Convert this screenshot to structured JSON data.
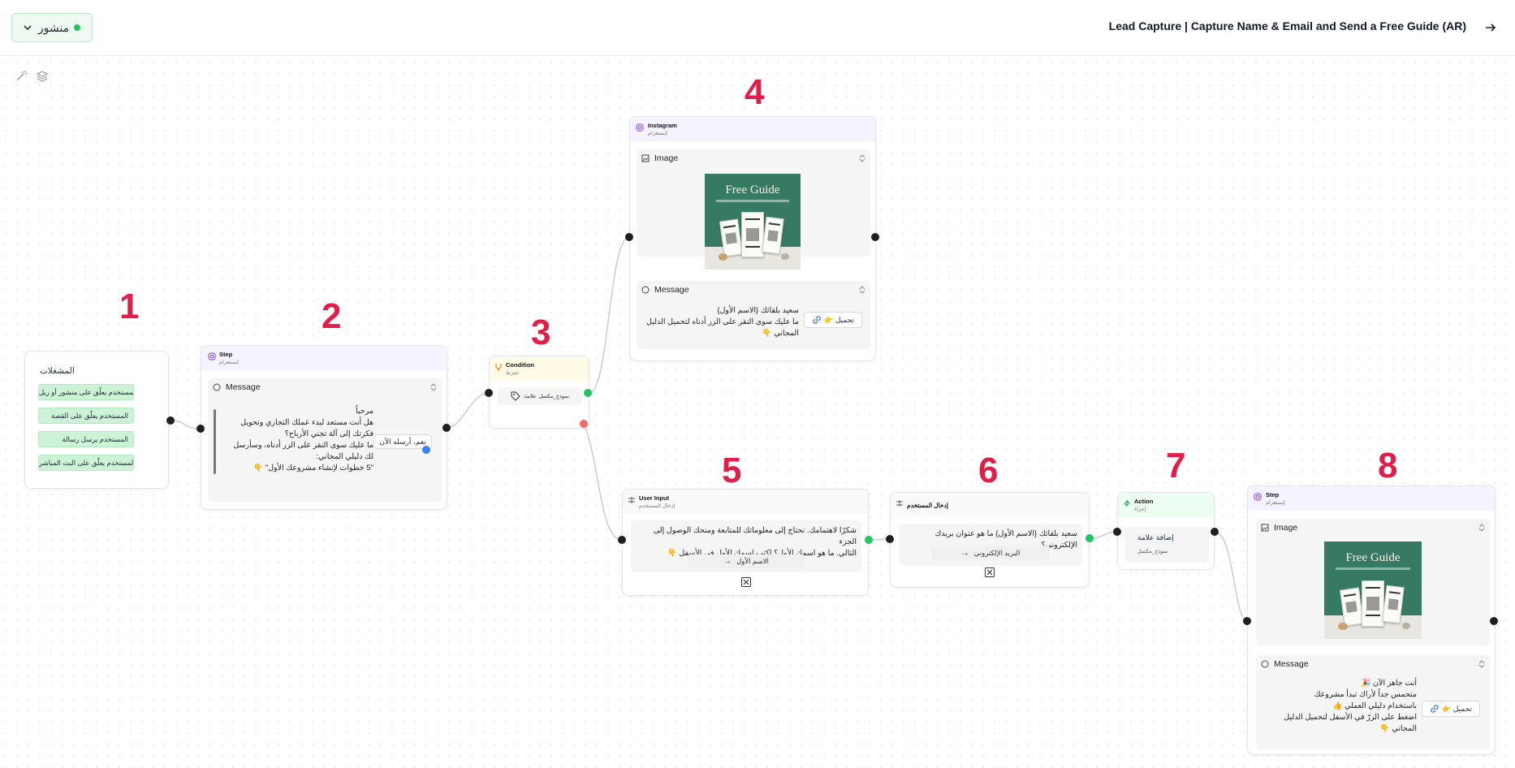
{
  "header": {
    "status_label": "منشور",
    "flow_title": "Lead Capture | Capture Name & Email and Send a Free Guide (AR)"
  },
  "colors": {
    "trigger_green": "#cdf3d6",
    "status_green": "#22c55e",
    "number_red": "#e11d48",
    "instagram_purple": "#f5f3ff",
    "condition_yellow": "#fffbe6"
  },
  "icons": {
    "back": "arrow-right-icon",
    "chevron": "chevron-down-icon",
    "magic": "magic-wand-icon",
    "layers": "layers-icon"
  },
  "numbers": [
    "1",
    "2",
    "3",
    "4",
    "5",
    "6",
    "7",
    "8"
  ],
  "triggers_node": {
    "title": "المشغلات",
    "items": [
      "المستخدم يعلّق على منشور أو ريل",
      "المستخدم يعلّق على القصة",
      "المستخدم يرسل رسالة",
      "المستخدم يعلّق على البث المباشر"
    ]
  },
  "step_node": {
    "title": "Step",
    "subtitle": "إنستغرام",
    "section": "Message",
    "message": [
      "مرحباً",
      "هل أنت مستعد لبدء عملك التجاري وتحويل",
      "فكرتك إلى آلة تجني الأرباح؟",
      "ما عليك سوى النقر على الزر أدناه، وسأرسل",
      "لك دليلي المجاني:",
      "\"5 خطوات لإنشاء مشروعك الأول\" 👇"
    ],
    "button": "نعم، أرسله الآن"
  },
  "condition_node": {
    "title": "Condition",
    "subtitle": "شرط",
    "tag": "نموذج_مكتمل",
    "tag_label": ":علامة"
  },
  "instagram_node": {
    "title": "Instagram",
    "subtitle": "إنستغرام",
    "image_section": "Image",
    "message_section": "Message",
    "image_text": "Free Guide",
    "message": [
      "سعيد بلقائك {الاسم الأول}",
      "ما عليك سوى النقر على الزر أدناه لتحميل الدليل",
      "المجاني 👇"
    ],
    "button": "👉 تحميل"
  },
  "user_input_node": {
    "title": "User Input",
    "subtitle": "إدخال المستخدم",
    "message": [
      "شكرًا لاهتمامك. نحتاج إلى معلوماتك للمتابعة ومنحك الوصول إلى الجزء",
      "التالي. ما هو اسمك الأول؟ اكتب اسمك الأول في الأسفل 👇"
    ],
    "field": "الاسم الأول"
  },
  "email_input_node": {
    "title": "إدخال المستخدم",
    "message": [
      "سعيد بلقائك {الاسم الأول} ما هو عنوان بريدك الإلكتروني؟"
    ],
    "field": "البريد الإلكتروني"
  },
  "action_node": {
    "title": "Action",
    "subtitle": "إجراء",
    "action": "إضافة علامة",
    "tag": "نموذج_مكتمل"
  },
  "final_node": {
    "title": "Step",
    "subtitle": "إنستغرام",
    "image_section": "Image",
    "message_section": "Message",
    "image_text": "Free Guide",
    "message": [
      "أنت جاهز الآن 🎉",
      "متحمس جداً لأراك تبدأ مشروعك",
      "باستخدام دليلي العملي 👍",
      "اضغط على الزرّ في الأسفل لتحميل الدليل",
      "المجاني 👇"
    ],
    "button": "👉 تحميل"
  }
}
